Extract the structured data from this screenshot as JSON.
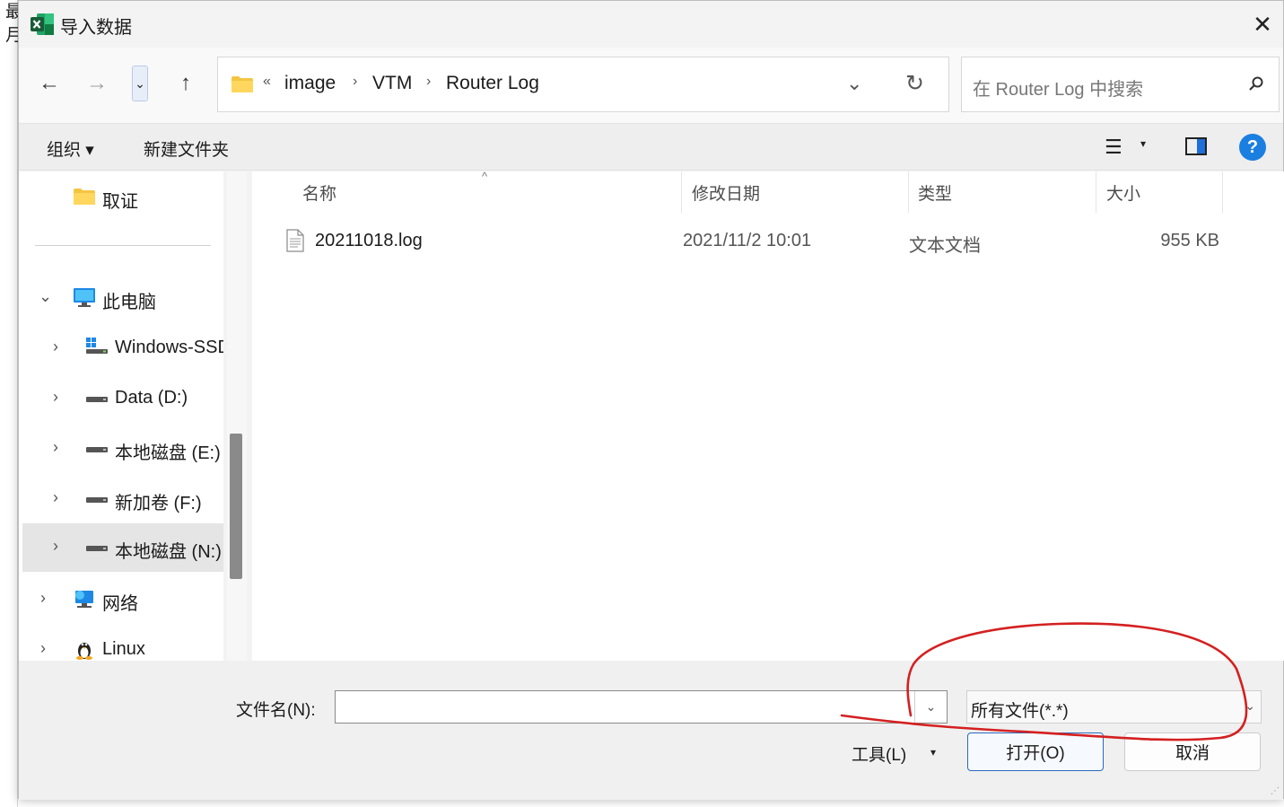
{
  "window": {
    "title": "导入数据",
    "close_glyph": "✕"
  },
  "background": {
    "chars": [
      "最",
      "月"
    ]
  },
  "nav": {
    "back_glyph": "←",
    "forward_glyph": "→",
    "recent_glyph": "⌄",
    "up_glyph": "↑"
  },
  "address": {
    "overflow": "«",
    "crumbs": [
      "image",
      "VTM",
      "Router Log"
    ],
    "separator": "›",
    "dropdown_glyph": "⌄",
    "refresh_glyph": "↻"
  },
  "search": {
    "placeholder": "在 Router Log 中搜索",
    "icon": "search-icon"
  },
  "toolbar": {
    "organize": "组织 ▾",
    "new_folder": "新建文件夹",
    "view_glyph": "☰",
    "view_dropdown": "▾",
    "help": "?"
  },
  "tree": {
    "items": [
      {
        "label": "取证",
        "icon": "folder-icon"
      },
      {
        "label": "此电脑",
        "icon": "computer-icon",
        "chev": "⌄"
      },
      {
        "label": "Windows-SSD",
        "icon": "drive-windows-icon",
        "chev": "›"
      },
      {
        "label": "Data (D:)",
        "icon": "drive-icon",
        "chev": "›"
      },
      {
        "label": "本地磁盘 (E:)",
        "icon": "drive-icon",
        "chev": "›"
      },
      {
        "label": "新加卷 (F:)",
        "icon": "drive-icon",
        "chev": "›"
      },
      {
        "label": "本地磁盘 (N:)",
        "icon": "drive-icon",
        "chev": "›",
        "selected": true
      },
      {
        "label": "网络",
        "icon": "network-icon",
        "chev": "›"
      },
      {
        "label": "Linux",
        "icon": "linux-icon",
        "chev": "›"
      }
    ]
  },
  "files": {
    "columns": [
      "名称",
      "修改日期",
      "类型",
      "大小"
    ],
    "sort_glyph": "^",
    "rows": [
      {
        "name": "20211018.log",
        "date": "2021/11/2 10:01",
        "type": "文本文档",
        "size": "955 KB"
      }
    ]
  },
  "bottom": {
    "filename_label": "文件名(N):",
    "filename_value": "",
    "filter": "所有文件(*.*)",
    "tools": "工具(L)",
    "tools_dd": "▾",
    "open": "打开(O)",
    "cancel": "取消",
    "dd_glyph": "⌄"
  },
  "annotation_color": "#d42020"
}
